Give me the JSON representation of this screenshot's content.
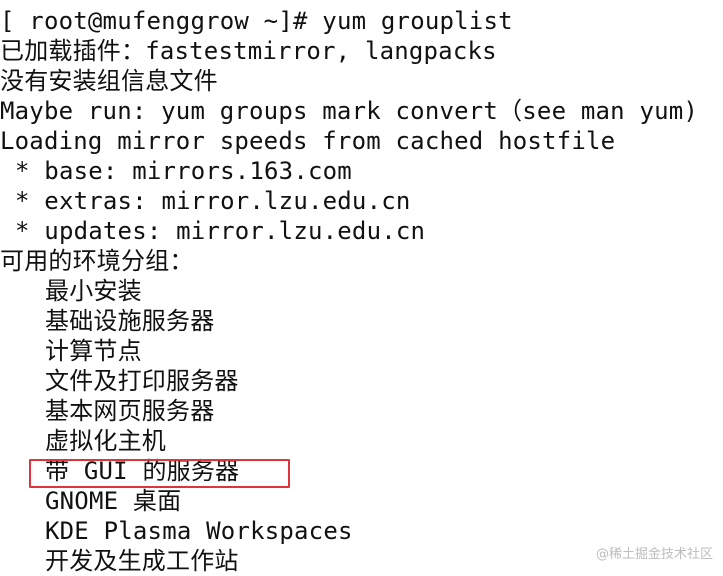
{
  "terminal": {
    "prompt": "[ root@mufenggrow ~]# ",
    "command": "yum grouplist",
    "output_lines": [
      "已加载插件：fastestmirror, langpacks",
      "没有安装组信息文件",
      "Maybe run: yum groups mark convert（see man yum)",
      "Loading mirror speeds from cached hostfile"
    ],
    "mirrors": [
      "* base: mirrors.163.com",
      "* extras: mirror.lzu.edu.cn",
      "* updates: mirror.lzu.edu.cn"
    ],
    "groups_header": "可用的环境分组：",
    "groups": [
      "最小安装",
      "基础设施服务器",
      "计算节点",
      "文件及打印服务器",
      "基本网页服务器",
      "虚拟化主机",
      "带 GUI 的服务器",
      "GNOME 桌面",
      "KDE Plasma Workspaces",
      "开发及生成工作站"
    ],
    "highlight_color": "#d9363e"
  },
  "watermark": "@稀土掘金技术社区"
}
